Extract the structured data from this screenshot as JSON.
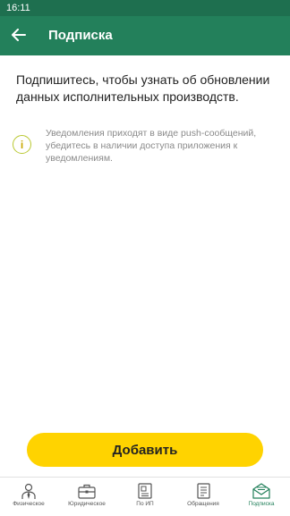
{
  "status_bar": {
    "time": "16:11"
  },
  "app_bar": {
    "title": "Подписка",
    "back_icon": "arrow-left-icon"
  },
  "main": {
    "heading": "Подпишитесь, чтобы узнать об обновлении данных исполнительных производств.",
    "notice": {
      "icon": "info-icon",
      "icon_glyph": "i",
      "text": "Уведомления приходят в виде push-сообщений, убедитесь в наличии доступа приложения к уведомлениям."
    },
    "add_button_label": "Добавить"
  },
  "bottom_nav": {
    "items": [
      {
        "label": "Физическое",
        "icon": "person-icon",
        "active": false
      },
      {
        "label": "Юридическое",
        "icon": "briefcase-icon",
        "active": false
      },
      {
        "label": "По ИП",
        "icon": "document-id-icon",
        "active": false
      },
      {
        "label": "Обращения",
        "icon": "document-list-icon",
        "active": false
      },
      {
        "label": "Подписка",
        "icon": "envelope-icon",
        "active": true
      }
    ],
    "active_color": "#23805b",
    "inactive_color": "#555555"
  },
  "colors": {
    "brand": "#23805b",
    "status_bar": "#1e6f4f",
    "button": "#ffd300"
  }
}
